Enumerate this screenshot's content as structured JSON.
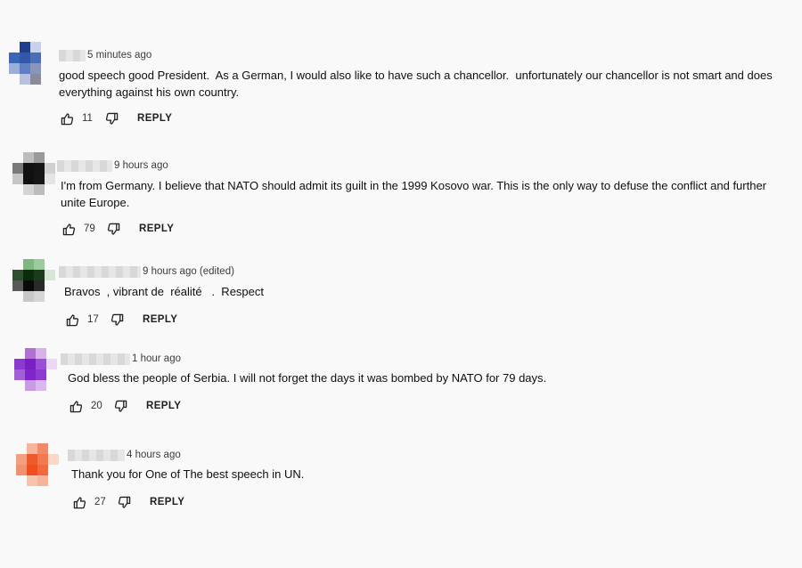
{
  "reply_label": "REPLY",
  "colors": {
    "background": "#f9f9f9",
    "text": "#0f0f0f"
  },
  "comments": [
    {
      "time": "5 minutes ago",
      "text": "good speech good President.  As a German, I would also like to have such a chancellor.  unfortunately our chancellor is not smart and does everything against his own country.",
      "likes": "11",
      "avatar": [
        "#f9f9f9",
        "#1f3f8a",
        "#c8d2ea",
        "#f9f9f9",
        "#3a66b8",
        "#3557a8",
        "#4b6fb6",
        "#f9f9f9",
        "#9aaed8",
        "#5f7fc2",
        "#8a96b8",
        "#f9f9f9",
        "#f9f9f9",
        "#b8c2dc",
        "#8a8a9a",
        "#f9f9f9"
      ]
    },
    {
      "time": "9 hours ago",
      "text": "I'm from Germany. I believe that NATO should admit its guilt in the 1999 Kosovo war. This is the only way to defuse the conflict and further unite Europe.",
      "likes": "79",
      "avatar": [
        "#f9f9f9",
        "#bdbdbd",
        "#9a9a9a",
        "#f9f9f9",
        "#7a7a7a",
        "#111111",
        "#151515",
        "#d0d0d0",
        "#c6c6c6",
        "#101010",
        "#161616",
        "#e4e4e4",
        "#f9f9f9",
        "#d4d4d4",
        "#bcbcbc",
        "#f9f9f9"
      ]
    },
    {
      "time": "9 hours ago (edited)",
      "text": "Bravos  , vibrant de  réalité   .  Respect",
      "likes": "17",
      "avatar": [
        "#f9f9f9",
        "#7fb87f",
        "#9ccc9c",
        "#f9f9f9",
        "#2e4e2e",
        "#0e2a0e",
        "#1b3b1b",
        "#d7e6d7",
        "#5a5a5a",
        "#0a0a0a",
        "#2a2a2a",
        "#f9f9f9",
        "#f9f9f9",
        "#c8c8c8",
        "#d6d6d6",
        "#f9f9f9"
      ]
    },
    {
      "time": "1 hour ago",
      "text": "God bless the people of Serbia. I will not forget the days it was bombed by NATO for 79 days.",
      "likes": "20",
      "avatar": [
        "#f9f9f9",
        "#b26fd6",
        "#d7b2ea",
        "#f9f9f9",
        "#8a3ad0",
        "#7a1fc6",
        "#9b4fd8",
        "#ead8f4",
        "#a35fd6",
        "#7e26c8",
        "#8e3ad0",
        "#f9f9f9",
        "#f9f9f9",
        "#c99be4",
        "#d8b8ee",
        "#f9f9f9"
      ]
    },
    {
      "time": "4 hours ago",
      "text": "Thank you for One of The best speech in UN.",
      "likes": "27",
      "avatar": [
        "#f9f9f9",
        "#f6b49c",
        "#f08a6a",
        "#f9f9f9",
        "#f4a080",
        "#ee5a2e",
        "#f27a52",
        "#fbd7c9",
        "#f2916f",
        "#ef4f1f",
        "#f06a3e",
        "#f9f9f9",
        "#f9f9f9",
        "#f7c2ae",
        "#f5b39a",
        "#f9f9f9"
      ]
    }
  ]
}
